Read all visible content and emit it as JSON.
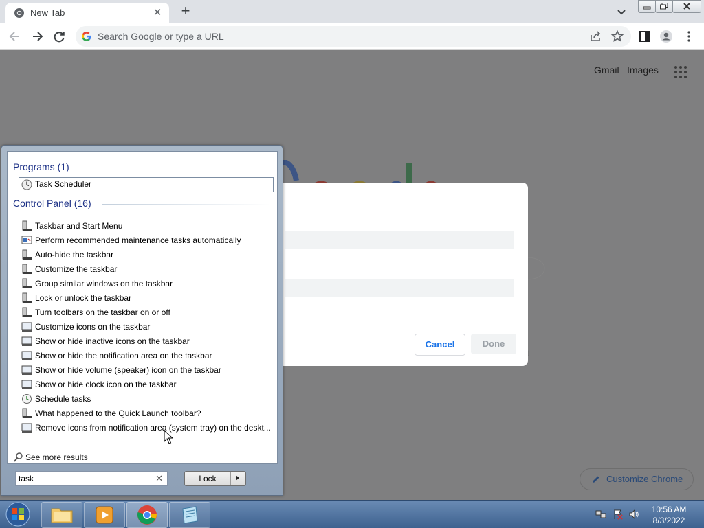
{
  "browser": {
    "tab": {
      "title": "New Tab",
      "close_icon": "close-icon"
    },
    "new_tab_icon": "plus-icon",
    "omnibox": {
      "placeholder": "Search Google or type a URL"
    },
    "page_links": {
      "gmail": "Gmail",
      "images": "Images"
    },
    "customize_chrome": "Customize Chrome",
    "dialog": {
      "cancel_label": "Cancel",
      "done_label": "Done"
    }
  },
  "start_menu": {
    "programs_header": "Programs (1)",
    "program": "Task Scheduler",
    "control_panel_header": "Control Panel (16)",
    "items": [
      {
        "label": "Taskbar and Start Menu",
        "icon": "taskbar-icon"
      },
      {
        "label": "Perform recommended maintenance tasks automatically",
        "icon": "action-center-icon"
      },
      {
        "label": "Auto-hide the taskbar",
        "icon": "taskbar-icon"
      },
      {
        "label": "Customize the taskbar",
        "icon": "taskbar-icon"
      },
      {
        "label": "Group similar windows on the taskbar",
        "icon": "taskbar-icon"
      },
      {
        "label": "Lock or unlock the taskbar",
        "icon": "taskbar-icon"
      },
      {
        "label": "Turn toolbars on the taskbar on or off",
        "icon": "taskbar-icon"
      },
      {
        "label": "Customize icons on the taskbar",
        "icon": "notification-icon"
      },
      {
        "label": "Show or hide inactive icons on the taskbar",
        "icon": "notification-icon"
      },
      {
        "label": "Show or hide the notification area on the taskbar",
        "icon": "notification-icon"
      },
      {
        "label": "Show or hide volume (speaker) icon on the taskbar",
        "icon": "notification-icon"
      },
      {
        "label": "Show or hide clock icon on the taskbar",
        "icon": "notification-icon"
      },
      {
        "label": "Schedule tasks",
        "icon": "schedule-icon"
      },
      {
        "label": "What happened to the Quick Launch toolbar?",
        "icon": "taskbar-icon"
      },
      {
        "label": "Remove icons from notification area (system tray) on the deskt...",
        "icon": "notification-icon"
      }
    ],
    "see_more": "See more results",
    "search_value": "task",
    "lock_label": "Lock"
  },
  "taskbar": {
    "time": "10:56 AM",
    "date": "8/3/2022"
  }
}
